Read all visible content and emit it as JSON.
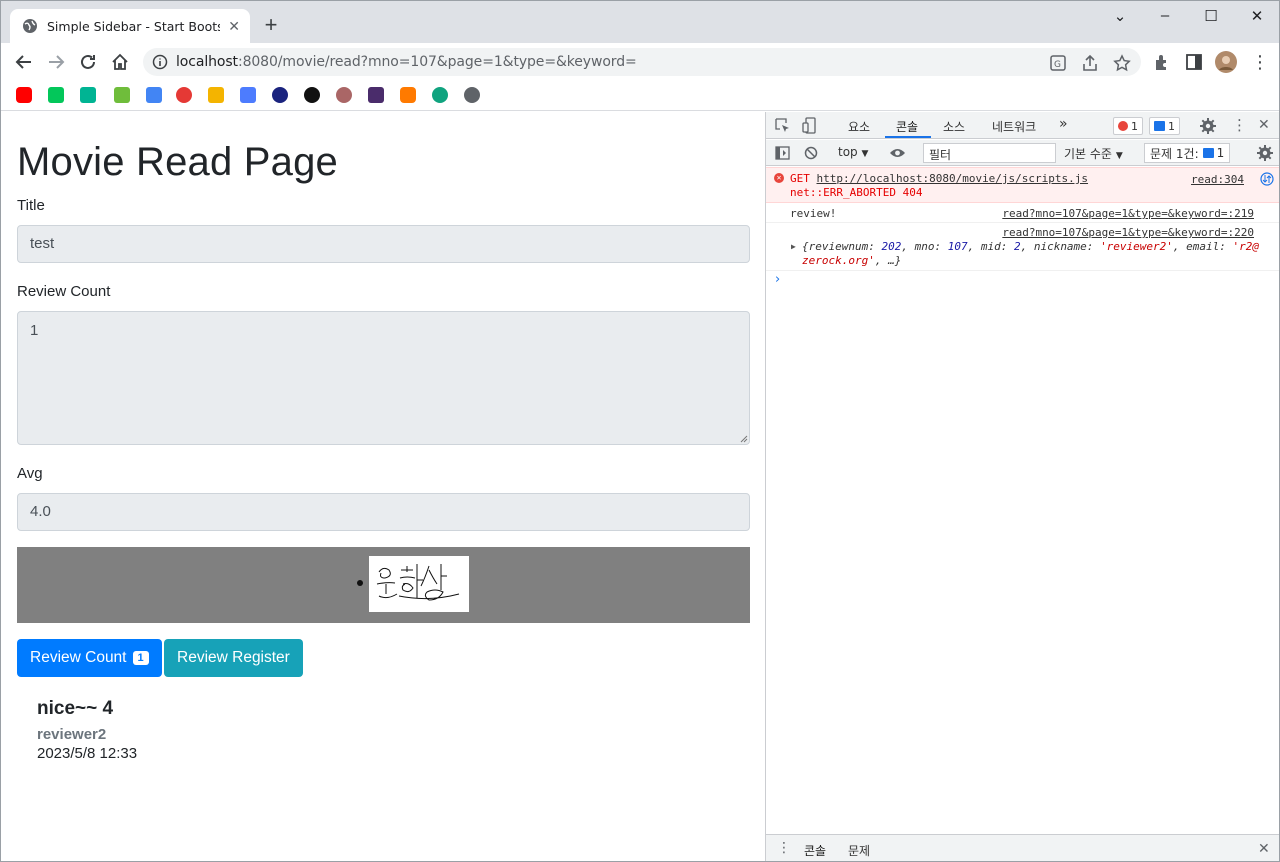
{
  "browser": {
    "tab_title": "Simple Sidebar - Start Bootstrap",
    "url_host": "localhost",
    "url_rest": ":8080/movie/read?mno=107&page=1&type=&keyword=",
    "bookmark_colors": [
      "#ff0000",
      "#03c75a",
      "#00b493",
      "#6fbd3b",
      "#4285f4",
      "#e53935",
      "#f4b400",
      "#4d7cfe",
      "#1a237e",
      "#111111",
      "#a66",
      "#4a2c6b",
      "#ff7a00",
      "#10a37f",
      "#5f6368"
    ]
  },
  "page": {
    "title": "Movie Read Page",
    "fields": {
      "title_label": "Title",
      "title_value": "test",
      "review_count_label": "Review Count",
      "review_count_value": "1",
      "avg_label": "Avg",
      "avg_value": "4.0"
    },
    "buttons": {
      "review_count": "Review Count",
      "review_count_badge": "1",
      "review_register": "Review Register"
    },
    "review": {
      "text": "nice~~ 4",
      "user": "reviewer2",
      "date": "2023/5/8 12:33"
    }
  },
  "devtools": {
    "tabs": [
      "요소",
      "콘솔",
      "소스",
      "네트워크"
    ],
    "more": "»",
    "error_count": "1",
    "message_count": "1",
    "context": "top",
    "filter_placeholder": "필터",
    "level": "기본 수준",
    "issues_label": "문제 1건:",
    "issues_count": "1",
    "console": {
      "error_line1_prefix": "GET",
      "error_url": "http://localhost:8080/movie/js/scripts.js",
      "error_line2": "net::ERR_ABORTED 404",
      "error_source": "read:304",
      "log_text": "review!",
      "log_source": "read?mno=107&page=1&type=&keyword=:219",
      "obj_source": "read?mno=107&page=1&type=&keyword=:220",
      "obj_line1_a": "{reviewnum: ",
      "obj_reviewnum": "202",
      "obj_line1_b": ", mno: ",
      "obj_mno": "107",
      "obj_line1_c": ", mid: ",
      "obj_mid": "2",
      "obj_line1_d": ", nickname: ",
      "obj_nickname": "'reviewer2'",
      "obj_line1_e": ", email: ",
      "obj_email_a": "'r2@",
      "obj_email_b": "zerock.org'",
      "obj_line2_tail": ", …}",
      "prompt": "›"
    },
    "drawer_tabs": [
      "콘솔",
      "문제"
    ]
  }
}
